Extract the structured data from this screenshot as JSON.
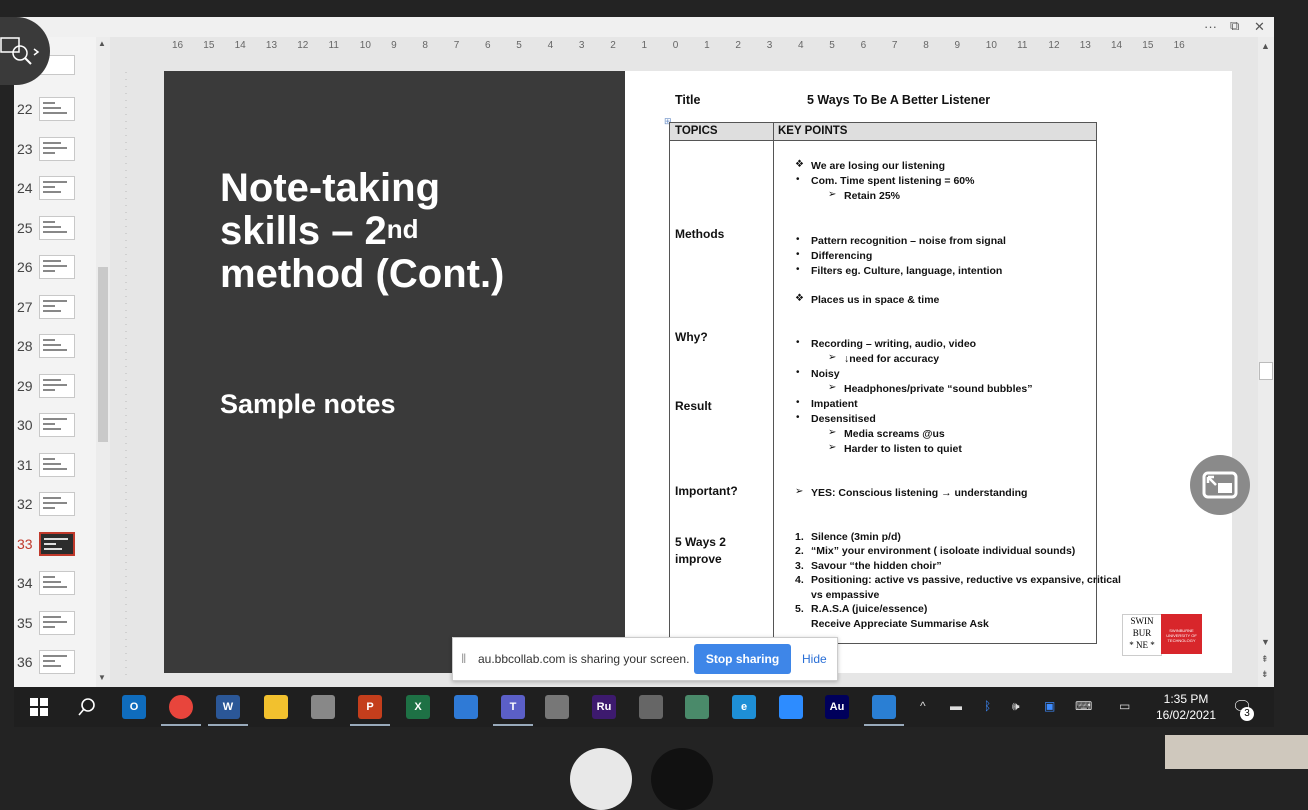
{
  "thumbnails": [
    {
      "num": "22",
      "active": false
    },
    {
      "num": "23",
      "active": false
    },
    {
      "num": "24",
      "active": false
    },
    {
      "num": "25",
      "active": false
    },
    {
      "num": "26",
      "active": false
    },
    {
      "num": "27",
      "active": false
    },
    {
      "num": "28",
      "active": false
    },
    {
      "num": "29",
      "active": false
    },
    {
      "num": "30",
      "active": false
    },
    {
      "num": "31",
      "active": false
    },
    {
      "num": "32",
      "active": false
    },
    {
      "num": "33",
      "active": true
    },
    {
      "num": "34",
      "active": false
    },
    {
      "num": "35",
      "active": false
    },
    {
      "num": "36",
      "active": false
    }
  ],
  "ruler": {
    "labels": [
      "16",
      "15",
      "14",
      "13",
      "12",
      "11",
      "10",
      "9",
      "8",
      "7",
      "6",
      "5",
      "4",
      "3",
      "2",
      "1",
      "0",
      "1",
      "2",
      "3",
      "4",
      "5",
      "6",
      "7",
      "8",
      "9",
      "10",
      "11",
      "12",
      "13",
      "14",
      "15",
      "16"
    ]
  },
  "slide": {
    "title_line1": "Note-taking",
    "title_line2_pre": "skills – 2",
    "title_line2_sup": "nd",
    "title_line3": "method (Cont.)",
    "subtitle": "Sample notes"
  },
  "notes": {
    "title_label": "Title",
    "title_value": "5 Ways To Be A Better Listener",
    "col_topics": "TOPICS",
    "col_keypoints": "KEY POINTS",
    "topics": [
      "Methods",
      "Why?",
      "Result",
      "Important?",
      "5 Ways 2",
      "improve"
    ],
    "points": {
      "p1": "We are losing our listening",
      "p2": "Com. Time spent listening = 60%",
      "p3": "Retain 25%",
      "p4": "Pattern recognition – noise from signal",
      "p5": "Differencing",
      "p6": "Filters eg. Culture, language, intention",
      "p7": "Places us in space & time",
      "p8": "Recording – writing, audio, video",
      "p9": "↓need for accuracy",
      "p10": "Noisy",
      "p11": "Headphones/private “sound bubbles”",
      "p12": "Impatient",
      "p13": "Desensitised",
      "p14": "Media screams @us",
      "p15": "Harder to listen  to quiet",
      "p16": "YES: Conscious listening → understanding",
      "p17": "Silence (3min p/d)",
      "p18": "“Mix” your environment ( isoloate individual sounds)",
      "p19": "Savour “the hidden choir”",
      "p20": "Positioning: active vs passive, reductive vs expansive, critical",
      "p21": "vs empassive",
      "p22": "R.A.S.A  (juice/essence)",
      "p23": "Receive Appreciate Summarise Ask"
    },
    "numbers": [
      "1.",
      "2.",
      "3.",
      "4.",
      "5."
    ]
  },
  "logo": {
    "line1": "SWIN",
    "line2": "BUR",
    "line3": "* NE *",
    "sub": "SWINBURNE UNIVERSITY OF TECHNOLOGY"
  },
  "share_bar": {
    "message": "au.bbcollab.com is sharing your screen.",
    "stop_label": "Stop sharing",
    "hide_label": "Hide"
  },
  "taskbar": {
    "time": "1:35 PM",
    "date": "16/02/2021",
    "notification_count": "3",
    "apps": [
      {
        "name": "outlook",
        "glyph": "O",
        "color": "#0f6cbd"
      },
      {
        "name": "chrome",
        "glyph": "",
        "color": "#e8453c"
      },
      {
        "name": "word",
        "glyph": "W",
        "color": "#2b5797"
      },
      {
        "name": "explorer",
        "glyph": "",
        "color": "#f2c12e"
      },
      {
        "name": "paint",
        "glyph": "",
        "color": "#888888"
      },
      {
        "name": "powerpoint",
        "glyph": "P",
        "color": "#c43e1c"
      },
      {
        "name": "excel",
        "glyph": "X",
        "color": "#1e7145"
      },
      {
        "name": "onedrive",
        "glyph": "",
        "color": "#2f7ad6"
      },
      {
        "name": "teams",
        "glyph": "T",
        "color": "#5b5fc7"
      },
      {
        "name": "camera",
        "glyph": "",
        "color": "#777777"
      },
      {
        "name": "rush",
        "glyph": "Ru",
        "color": "#3d1a6e"
      },
      {
        "name": "mic",
        "glyph": "",
        "color": "#666666"
      },
      {
        "name": "globe",
        "glyph": "",
        "color": "#4a8a6a"
      },
      {
        "name": "ie",
        "glyph": "e",
        "color": "#1e8fd6"
      },
      {
        "name": "zoom",
        "glyph": "",
        "color": "#2d8cff"
      },
      {
        "name": "audition",
        "glyph": "Au",
        "color": "#00005b"
      },
      {
        "name": "photos",
        "glyph": "",
        "color": "#2a7fd4"
      }
    ]
  }
}
